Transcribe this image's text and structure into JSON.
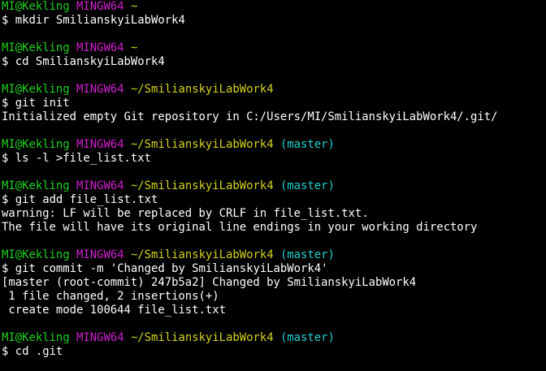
{
  "colors": {
    "background": "#000000",
    "user_host": "#1ed21e",
    "mingw": "#d21ed2",
    "path": "#d2d21e",
    "branch": "#1ed2d2",
    "text": "#ffffff"
  },
  "prompt": {
    "user_host": "MI@Kekling",
    "system": "MINGW64",
    "symbol": "$"
  },
  "blocks": [
    {
      "path": "~",
      "branch": "",
      "command": "mkdir SmilianskyiLabWork4",
      "output": []
    },
    {
      "path": "~",
      "branch": "",
      "command": "cd SmilianskyiLabWork4",
      "output": []
    },
    {
      "path": "~/SmilianskyiLabWork4",
      "branch": "",
      "command": "git init",
      "output": [
        "Initialized empty Git repository in C:/Users/MI/SmilianskyiLabWork4/.git/"
      ]
    },
    {
      "path": "~/SmilianskyiLabWork4",
      "branch": "(master)",
      "command": "ls -l >file_list.txt",
      "output": []
    },
    {
      "path": "~/SmilianskyiLabWork4",
      "branch": "(master)",
      "command": "git add file_list.txt",
      "output": [
        "warning: LF will be replaced by CRLF in file_list.txt.",
        "The file will have its original line endings in your working directory"
      ]
    },
    {
      "path": "~/SmilianskyiLabWork4",
      "branch": "(master)",
      "command": "git commit -m 'Changed by SmilianskyiLabWork4'",
      "output": [
        "[master (root-commit) 247b5a2] Changed by SmilianskyiLabWork4",
        " 1 file changed, 2 insertions(+)",
        " create mode 100644 file_list.txt"
      ]
    },
    {
      "path": "~/SmilianskyiLabWork4",
      "branch": "(master)",
      "command": "cd .git",
      "output": []
    }
  ]
}
